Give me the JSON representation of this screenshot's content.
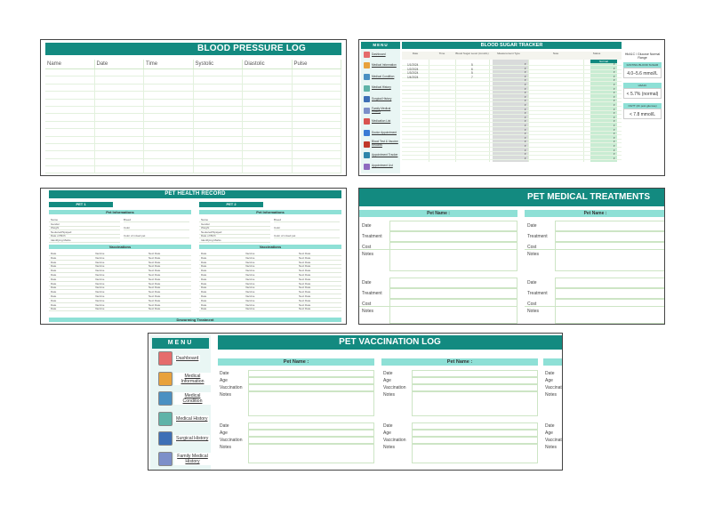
{
  "bp": {
    "title": "BLOOD PRESSURE LOG",
    "columns": [
      "Name",
      "Date",
      "Time",
      "Systolic",
      "Diastolic",
      "Pulse"
    ]
  },
  "sugar": {
    "menu_title": "MENU",
    "title": "BLOOD SUGAR TRACKER",
    "menu": [
      {
        "label": "Dashboard",
        "icon": "house-icon",
        "color": "#e56c6c"
      },
      {
        "label": "Medical Information",
        "icon": "clipboard-icon",
        "color": "#e8a23c"
      },
      {
        "label": "Medical Condition",
        "icon": "stethoscope-icon",
        "color": "#4a90c2"
      },
      {
        "label": "Medical History",
        "icon": "chart-icon",
        "color": "#5fb3a8"
      },
      {
        "label": "Surgical History",
        "icon": "bed-icon",
        "color": "#3d6fb6"
      },
      {
        "label": "Family Medical History",
        "icon": "family-icon",
        "color": "#7c8fc9"
      },
      {
        "label": "Medication List",
        "icon": "pill-icon",
        "color": "#d9534f"
      },
      {
        "label": "Doctor Appointment",
        "icon": "calendar-icon",
        "color": "#3a7bd5"
      },
      {
        "label": "Blood Test & Vaccine Records",
        "icon": "vial-icon",
        "color": "#c0392b"
      },
      {
        "label": "Appointment Tracker",
        "icon": "clock-icon",
        "color": "#2e86ab"
      },
      {
        "label": "Appointment List",
        "icon": "list-icon",
        "color": "#8e6bbf"
      }
    ],
    "columns": [
      "Date",
      "Time",
      "Blood Sugar Level (mmol/L)",
      "Measurement Type",
      "Note",
      "Status"
    ],
    "rows": [
      {
        "date": "1/1/2024",
        "level": "5"
      },
      {
        "date": "1/2/2024",
        "level": "6"
      },
      {
        "date": "1/3/2024",
        "level": "5"
      },
      {
        "date": "1/4/2024",
        "level": "7"
      }
    ],
    "status_header": "Normal",
    "side_heading": "HbA1C / Glucose Normal Range",
    "side": [
      {
        "label": "FASTING BLOOD SUGAR",
        "value": "4.0–5.6 mmol/L"
      },
      {
        "label": "HbA1C",
        "value": "< 5.7% (normal)"
      },
      {
        "label": "OGTT (2h post glucose)",
        "value": "< 7.8 mmol/L"
      }
    ]
  },
  "health": {
    "title": "PET HEALTH RECORD",
    "pet1": "PET 1",
    "pet2": "PET 2",
    "info_title": "Pet Informations",
    "vacc_title": "Vaccinations",
    "deworm_title": "Deworming Treatment",
    "info_left": [
      "Name",
      "Gender",
      "Weight",
      "Neutered/Spayed",
      "Date of Birth",
      "Identifying Marks"
    ],
    "info_right": [
      "Breed",
      "Color",
      "Color of mixed pet"
    ],
    "vacc_cols": [
      "Date",
      "Vaccine",
      "Next Date"
    ]
  },
  "treat": {
    "title": "PET MEDICAL TREATMENTS",
    "pet_label": "Pet Name :",
    "labels_a": [
      "Date",
      "Treatment",
      "Cost",
      "Notes"
    ]
  },
  "vacc": {
    "menu_title": "MENU",
    "title": "PET VACCINATION LOG",
    "pet_label": "Pet Name :",
    "labels": [
      "Date",
      "Age",
      "Vaccination",
      "Notes"
    ],
    "menu": [
      {
        "label": "Dashboard",
        "icon": "house-icon",
        "color": "#e56c6c"
      },
      {
        "label": "Medical Information",
        "icon": "clipboard-icon",
        "color": "#e8a23c"
      },
      {
        "label": "Medical Condition",
        "icon": "stethoscope-icon",
        "color": "#4a90c2"
      },
      {
        "label": "Medical History",
        "icon": "chart-icon",
        "color": "#5fb3a8"
      },
      {
        "label": "Surgical History",
        "icon": "bed-icon",
        "color": "#3d6fb6"
      },
      {
        "label": "Family Medical History",
        "icon": "family-icon",
        "color": "#7c8fc9"
      }
    ]
  }
}
